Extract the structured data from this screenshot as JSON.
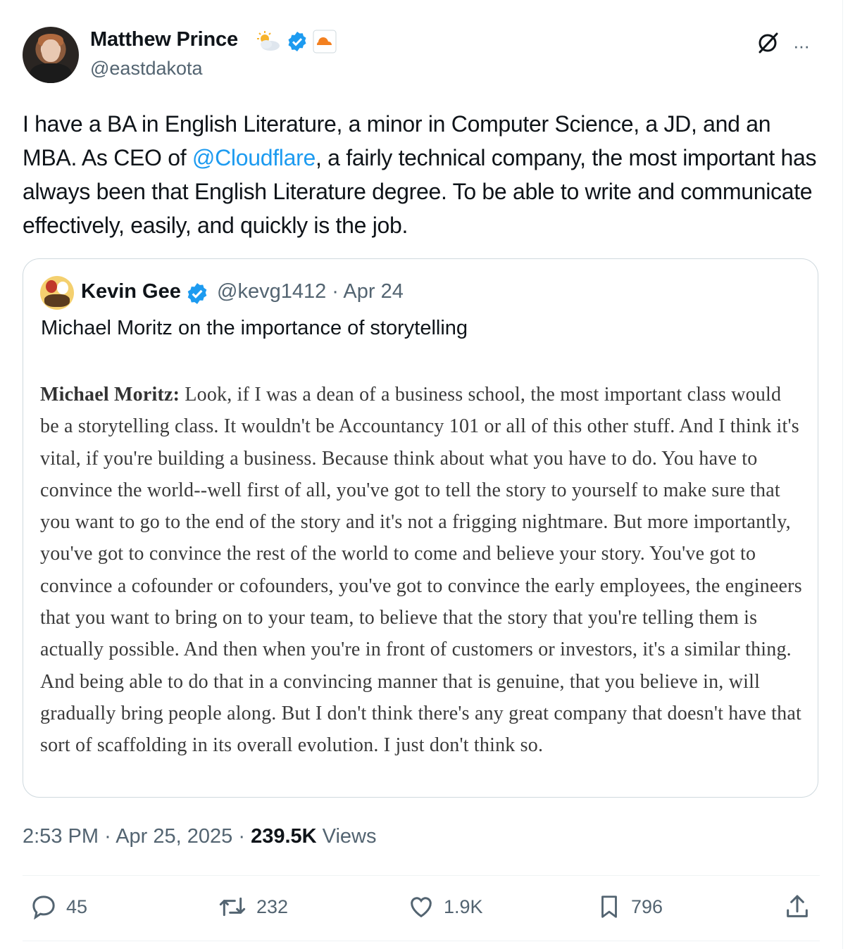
{
  "tweet": {
    "author": {
      "name": "Matthew Prince",
      "handle": "@eastdakota"
    },
    "text_before": "I have a BA in English Literature, a minor in Computer Science, a JD, and an MBA. As CEO of ",
    "mention": "@Cloudflare",
    "text_after": ", a fairly technical company, the most important has always been that English Literature degree. To be able to write and communicate effectively, easily, and quickly is the job.",
    "more_label": "···"
  },
  "quote": {
    "author": {
      "name": "Kevin Gee",
      "handle": "@kevg1412",
      "date": "· Apr 24"
    },
    "text": "Michael Moritz on the importance of storytelling",
    "image_speaker": "Michael Moritz:",
    "image_text": " Look, if I was a dean of a business school, the most important class would be a storytelling class. It wouldn't be Accountancy 101 or all of this other stuff. And I think it's vital, if you're building a business. Because think about what you have to do. You have to convince the world--well first of all, you've got to tell the story to yourself to make sure that you want to go to the end of the story and it's not a frigging nightmare. But more importantly, you've got to convince the rest of the world to come and believe your story. You've got to convince a cofounder or cofounders, you've got to convince the early employees, the engineers that you want to bring on to your team, to believe that the story that you're telling them is actually possible. And then when you're in front of customers or investors, it's a similar thing. And being able to do that in a convincing manner that is genuine, that you believe in, will gradually bring people along. But I don't think there's any great company that doesn't have that sort of scaffolding in its overall evolution. I just don't think so."
  },
  "meta": {
    "time": "2:53 PM",
    "date": "Apr 25, 2025",
    "views_count": "239.5K",
    "views_label": "Views"
  },
  "actions": {
    "replies": "45",
    "retweets": "232",
    "likes": "1.9K",
    "bookmarks": "796"
  },
  "colors": {
    "accent": "#1d9bf0",
    "muted": "#536471",
    "border": "#cfd9de"
  },
  "icons": [
    "weather-sun-cloud-icon",
    "verified-badge-icon",
    "cloudflare-logo-icon",
    "grok-icon",
    "more-icon",
    "reply-icon",
    "retweet-icon",
    "like-icon",
    "bookmark-icon",
    "share-icon"
  ]
}
